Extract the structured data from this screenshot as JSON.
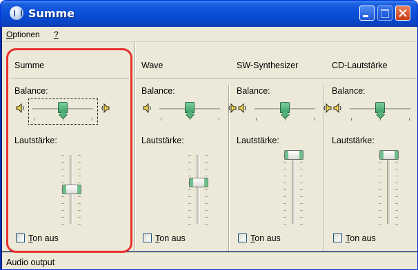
{
  "window": {
    "title": "Summe",
    "icon": "mixer-icon"
  },
  "menu": {
    "options_prefix": "",
    "options_access": "O",
    "options_rest": "ptionen",
    "help_label": "?"
  },
  "channels": [
    {
      "name": "Summe",
      "balance_label": "Balance:",
      "volume_label": "Lautstärke:",
      "mute_access": "T",
      "mute_rest": "on aus",
      "muted": false,
      "balance": 0.5,
      "volume": 0.5
    },
    {
      "name": "Wave",
      "balance_label": "Balance:",
      "volume_label": "Lautstärke:",
      "mute_access": "T",
      "mute_rest": "on aus",
      "muted": false,
      "balance": 0.5,
      "volume": 0.6
    },
    {
      "name": "SW-Synthesizer",
      "balance_label": "Balance:",
      "volume_label": "Lautstärke:",
      "mute_access": "T",
      "mute_rest": "on aus",
      "muted": false,
      "balance": 0.5,
      "volume": 1.0
    },
    {
      "name": "CD-Lautstärke",
      "balance_label": "Balance:",
      "volume_label": "Lautstärke:",
      "mute_access": "T",
      "mute_rest": "on aus",
      "muted": false,
      "balance": 0.5,
      "volume": 1.0
    }
  ],
  "status": {
    "text": "Audio output"
  },
  "colors": {
    "accent": "#e8312f",
    "titlebar": "#0a4fd9",
    "thumb": "#3ea064"
  }
}
